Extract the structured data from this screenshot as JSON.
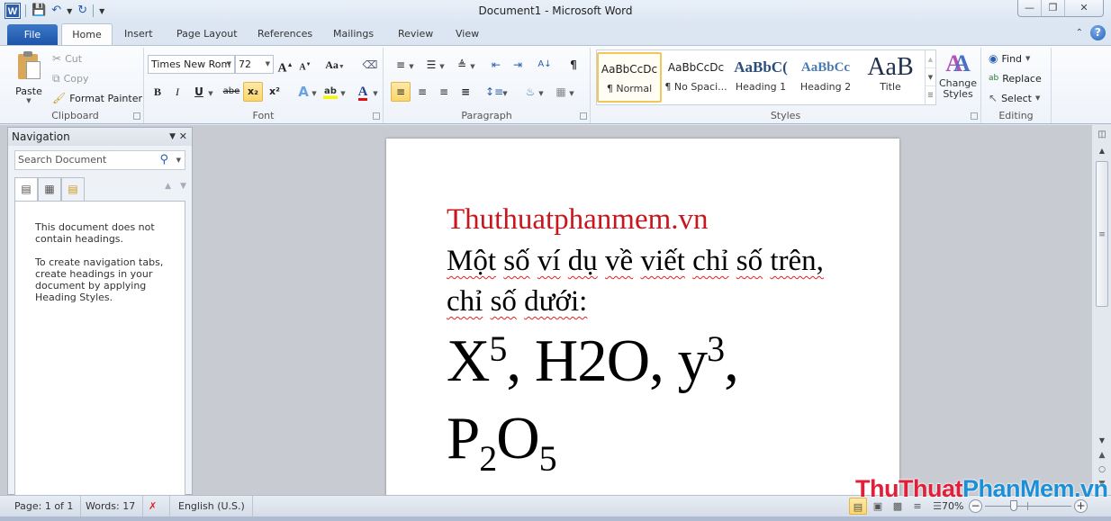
{
  "titlebar": {
    "title": "Document1  -  Microsoft Word",
    "app_icon": "W",
    "quick_access": [
      "save-icon",
      "undo-icon",
      "redo-icon",
      "customize-qat-icon"
    ],
    "window_controls": [
      "minimize",
      "restore",
      "close"
    ]
  },
  "tabs": [
    {
      "label": "File"
    },
    {
      "label": "Home",
      "active": true
    },
    {
      "label": "Insert"
    },
    {
      "label": "Page Layout"
    },
    {
      "label": "References"
    },
    {
      "label": "Mailings"
    },
    {
      "label": "Review"
    },
    {
      "label": "View"
    }
  ],
  "ribbon": {
    "clipboard": {
      "label": "Clipboard",
      "paste": "Paste",
      "cut": "Cut",
      "copy": "Copy",
      "format_painter": "Format Painter"
    },
    "font": {
      "label": "Font",
      "font_name": "Times New Rom",
      "font_size": "72",
      "grow": "A",
      "shrink": "A",
      "change_case": "Aa",
      "bold": "B",
      "italic": "I",
      "underline": "U",
      "strikethrough": "abe",
      "subscript": "x₂",
      "superscript": "x²",
      "text_effects": "A",
      "highlight": "ab",
      "font_color": "A",
      "highlight_color": "#f5f500",
      "font_color_value": "#e01010",
      "active_button": "subscript"
    },
    "paragraph": {
      "label": "Paragraph",
      "active_button": "align-left"
    },
    "styles": {
      "label": "Styles",
      "items": [
        {
          "sample": "AaBbCcDc",
          "name": "¶ Normal",
          "selected": true
        },
        {
          "sample": "AaBbCcDc",
          "name": "¶ No Spaci..."
        },
        {
          "sample": "AaBbC(",
          "name": "Heading 1"
        },
        {
          "sample": "AaBbCc",
          "name": "Heading 2"
        },
        {
          "sample": "AaB",
          "name": "Title"
        }
      ],
      "change_styles": "Change Styles"
    },
    "editing": {
      "label": "Editing",
      "find": "Find",
      "replace": "Replace",
      "select": "Select"
    }
  },
  "navigation": {
    "title": "Navigation",
    "search_placeholder": "Search Document",
    "message_1": "This document does not contain headings.",
    "message_2": "To create navigation tabs, create headings in your document by applying Heading Styles."
  },
  "document": {
    "title_line": "Thuthuatphanmem.vn",
    "title_color": "#c8161d",
    "line1_words": [
      "Một",
      "số",
      "ví",
      "dụ",
      "về",
      "viết",
      "chỉ",
      "số",
      "trên,"
    ],
    "line2_words": [
      "chỉ",
      "số",
      "dưới:"
    ],
    "formula1": {
      "base": "X",
      "sup": "5"
    },
    "formula_sep1": ", H2O, ",
    "formula2": {
      "base": "y",
      "sup": "3"
    },
    "formula_sep2": ",",
    "formula3": {
      "p": "P",
      "sub1": "2",
      "o": "O",
      "sub2": "5"
    }
  },
  "statusbar": {
    "page": "Page: 1 of 1",
    "words": "Words: 17",
    "language": "English (U.S.)",
    "zoom": "70%",
    "zoom_percent": 70
  },
  "watermark": {
    "part1": "ThuThuat",
    "part2": "PhanMem.vn"
  }
}
